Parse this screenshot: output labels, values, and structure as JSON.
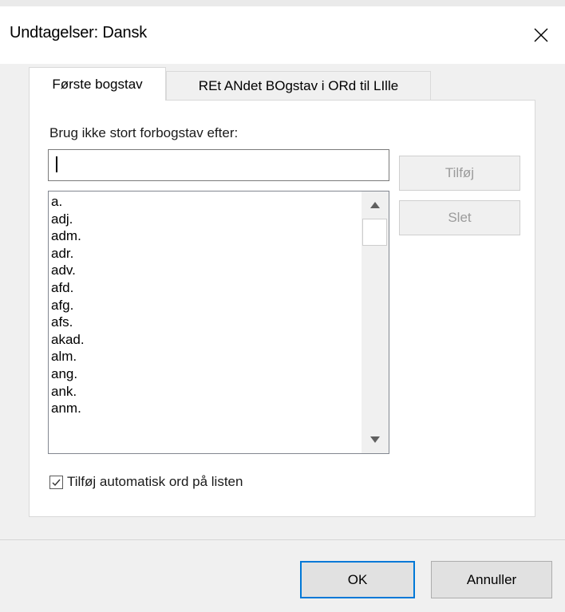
{
  "window": {
    "title": "Undtagelser: Dansk"
  },
  "tabs": [
    {
      "label": "Første bogstav",
      "active": true
    },
    {
      "label": "REt ANdet BOgstav i ORd til LIlle",
      "active": false
    }
  ],
  "first_letter": {
    "field_label": "Brug ikke stort forbogstav efter:",
    "input_value": "",
    "add_label": "Tilføj",
    "delete_label": "Slet",
    "list_items": [
      "a.",
      "adj.",
      "adm.",
      "adr.",
      "adv.",
      "afd.",
      "afg.",
      "afs.",
      "akad.",
      "alm.",
      "ang.",
      "ank.",
      "anm."
    ],
    "auto_add_label": "Tilføj automatisk ord på listen",
    "auto_add_checked": true
  },
  "footer": {
    "ok_label": "OK",
    "cancel_label": "Annuller"
  },
  "colors": {
    "dialog_bg": "#f0f0f0",
    "panel_bg": "#ffffff",
    "focus_border": "#0078d7",
    "disabled_text": "#9b9b9b"
  }
}
